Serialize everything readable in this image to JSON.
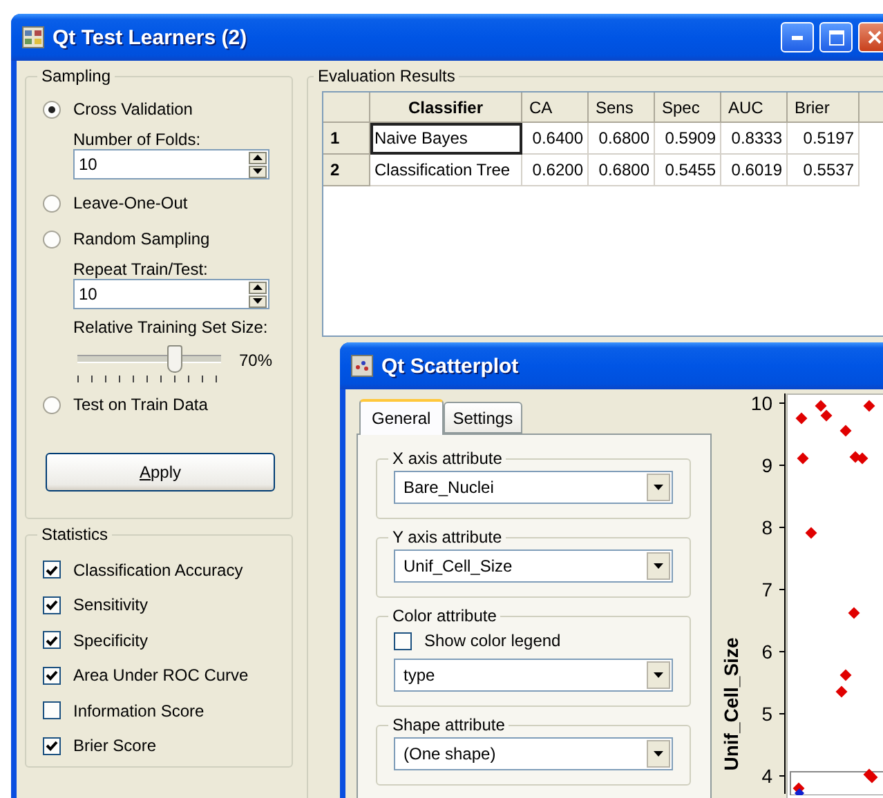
{
  "main_window": {
    "title": "Qt Test Learners (2)",
    "sampling": {
      "title": "Sampling",
      "items": [
        {
          "kind": "radio",
          "label": "Cross Validation",
          "selected": true
        },
        {
          "kind": "spin",
          "label": "Number of Folds:",
          "value": "10"
        },
        {
          "kind": "radio",
          "label": "Leave-One-Out",
          "selected": false
        },
        {
          "kind": "radio",
          "label": "Random Sampling",
          "selected": false
        },
        {
          "kind": "spin",
          "label": "Repeat Train/Test:",
          "value": "10"
        },
        {
          "kind": "slider",
          "label": "Relative Training Set Size:",
          "level": 0.7,
          "reading": "70%"
        },
        {
          "kind": "radio",
          "label": "Test on Train Data",
          "selected": false
        }
      ],
      "apply_button": "Apply"
    },
    "statistics": {
      "title": "Statistics",
      "items": [
        {
          "label": "Classification Accuracy",
          "checked": true
        },
        {
          "label": "Sensitivity",
          "checked": true
        },
        {
          "label": "Specificity",
          "checked": true
        },
        {
          "label": "Area Under ROC Curve",
          "checked": true
        },
        {
          "label": "Information Score",
          "checked": false
        },
        {
          "label": "Brier Score",
          "checked": true
        }
      ]
    },
    "results": {
      "title": "Evaluation Results",
      "columns": [
        "Classifier",
        "CA",
        "Sens",
        "Spec",
        "AUC",
        "Brier"
      ],
      "rows": [
        {
          "index": "1",
          "focused": true,
          "cells": [
            "Naive Bayes",
            "0.6400",
            "0.6800",
            "0.5909",
            "0.8333",
            "0.5197"
          ]
        },
        {
          "index": "2",
          "focused": false,
          "cells": [
            "Classification Tree",
            "0.6200",
            "0.6800",
            "0.5455",
            "0.6019",
            "0.5537"
          ]
        }
      ]
    }
  },
  "scatter_window": {
    "title": "Qt Scatterplot",
    "tabs": [
      {
        "label": "General",
        "selected": true
      },
      {
        "label": "Settings",
        "selected": false
      }
    ],
    "groups": [
      {
        "title": "X axis attribute",
        "value": "Bare_Nuclei"
      },
      {
        "title": "Y axis attribute",
        "value": "Unif_Cell_Size"
      },
      {
        "title": "Color attribute",
        "checkbox": {
          "label": "Show color legend",
          "checked": false
        },
        "value": "type"
      },
      {
        "title": "Shape attribute",
        "value": "(One shape)"
      }
    ],
    "plot": {
      "ylabel": "Unif_Cell_Size",
      "yticks": [
        "10",
        "9",
        "8",
        "7",
        "6",
        "5",
        "4"
      ]
    }
  }
}
